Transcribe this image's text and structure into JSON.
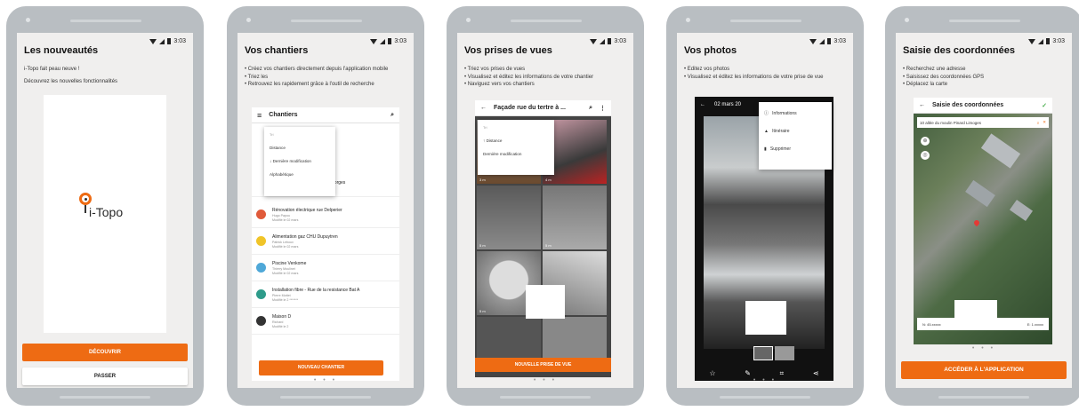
{
  "status": {
    "time": "3:03"
  },
  "screen1": {
    "title": "Les nouveautés",
    "line1": "i-Topo fait peau neuve !",
    "line2": "Découvrez les nouvelles fonctionnalités",
    "logo_text": "i-Topo",
    "primary_button": "DÉCOUVRIR",
    "secondary_button": "PASSER",
    "pager": "• • •"
  },
  "screen2": {
    "title": "Vos chantiers",
    "bullets": [
      "• Créez vos chantiers directement depuis l'application mobile",
      "• Triez les",
      "• Retrouvez les rapidement grâce à l'outil de recherche"
    ],
    "appbar_title": "Chantiers",
    "sort_menu": {
      "header": "Tri",
      "options": [
        "Distance",
        "Dernière modification",
        "Alphabétique"
      ]
    },
    "partial_item": "St Georges",
    "items": [
      {
        "title": "Rénovation électrique rue Delperier",
        "sub1": "Hugo Papou",
        "sub2": "Modifié le 02 mars",
        "color": "#e05a3a"
      },
      {
        "title": "Alimentation gaz CHU Dupuytren",
        "sub1": "Patrick Leboux",
        "sub2": "Modifié le 02 mars",
        "color": "#f0c428"
      },
      {
        "title": "Piscine Venkome",
        "sub1": "Thierry Moulinet",
        "sub2": "Modifié le 02 mars",
        "color": "#4fa8d8"
      },
      {
        "title": "Installation fibre - Rue de la resistance Bat A",
        "sub1": "Pierre Mottet",
        "sub2": "Modifié le 2 *******",
        "color": "#2e9b8a"
      },
      {
        "title": "Maison D",
        "sub1": "Richard",
        "sub2": "Modifié le 2",
        "color": "#333333"
      }
    ],
    "cta": "NOUVEAU CHANTIER",
    "pager": "• • •"
  },
  "screen3": {
    "title": "Vos prises de vues",
    "bullets": [
      "• Triez vos prises de vues",
      "• Visualisez et éditez les informations de votre chantier",
      "• Naviguez vers vos chantiers"
    ],
    "appbar_title": "Façade rue du tertre à ...",
    "sort_menu": {
      "header": "Tri",
      "options": [
        "Distance",
        "Dernière modification"
      ]
    },
    "tile_labels": [
      "3 m",
      "4 m",
      "5 m",
      "5 m",
      "5 m"
    ],
    "cta": "NOUVELLE PRISE DE VUE",
    "pager": "• • •"
  },
  "screen4": {
    "title": "Vos photos",
    "bullets": [
      "• Editez vos photos",
      "• Visualisez et éditez les informations de votre prise de vue"
    ],
    "date": "02 mars 20",
    "menu": [
      "Informations",
      "Itinéraire",
      "Supprimer"
    ],
    "pager": "• • •"
  },
  "screen5": {
    "title": "Saisie des coordonnées",
    "bullets": [
      "• Recherchez une adresse",
      "• Saisissez des coordonnées GPS",
      "• Déplacez la carte"
    ],
    "appbar_title": "Saisie des coordonnées",
    "search_value": "10 allée du moulin Pinard Limoges",
    "coord_left": "N: 45.xxxxx",
    "coord_right": "E: 1.xxxxx",
    "cta": "ACCÉDER À L'APPLICATION",
    "pager": "• • •"
  }
}
